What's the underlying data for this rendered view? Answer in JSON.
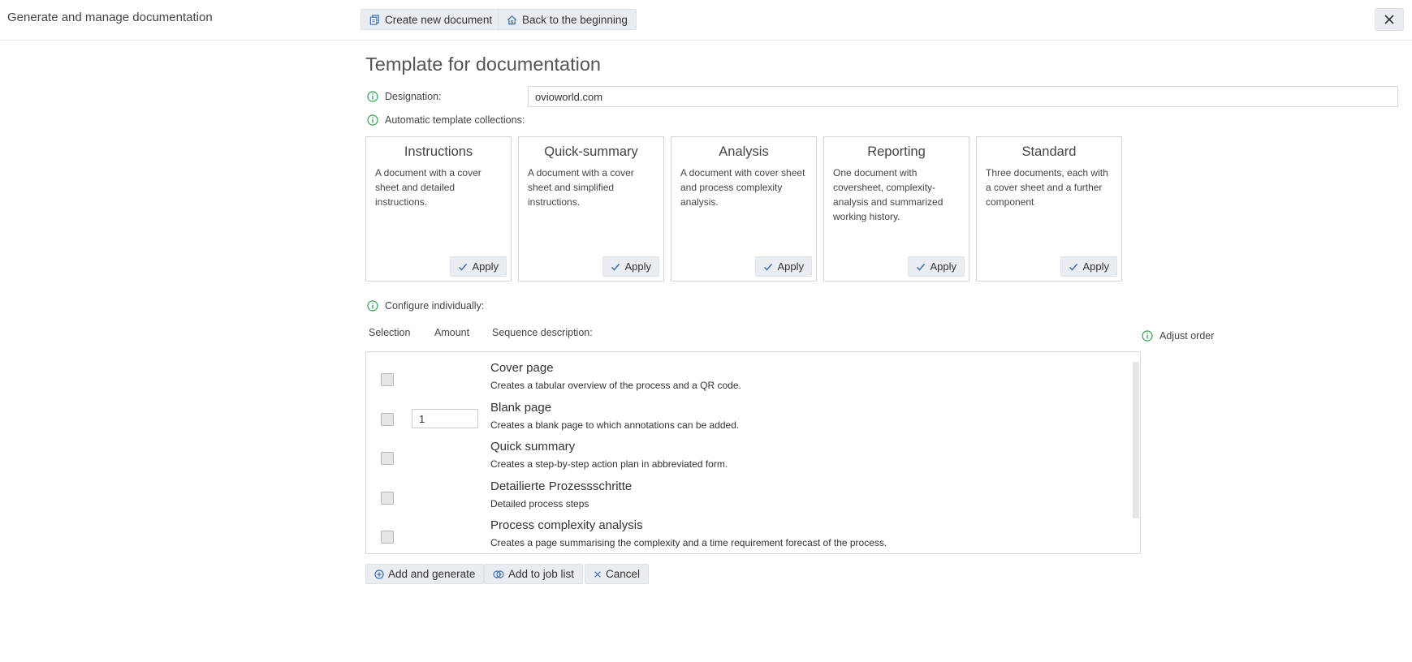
{
  "app": {
    "title": "Generate and manage documentation"
  },
  "toolbar": {
    "create_label": "Create new document",
    "back_label": "Back to the beginning"
  },
  "page": {
    "heading": "Template for documentation"
  },
  "designation": {
    "label": "Designation:",
    "value": "ovioworld.com"
  },
  "automatic": {
    "label": "Automatic template collections:",
    "apply_label": "Apply",
    "cards": [
      {
        "title": "Instructions",
        "description": "A document with a cover sheet and detailed instructions."
      },
      {
        "title": "Quick-summary",
        "description": "A document with a cover sheet and simplified instructions."
      },
      {
        "title": "Analysis",
        "description": "A document with cover sheet and process complexity analysis."
      },
      {
        "title": "Reporting",
        "description": "One document with coversheet, complexity-analysis and summarized working history."
      },
      {
        "title": "Standard",
        "description": "Three documents, each with a cover sheet and a further component"
      }
    ]
  },
  "configure": {
    "label": "Configure individually:",
    "adjust_order_label": "Adjust order",
    "columns": {
      "selection": "Selection",
      "amount": "Amount",
      "description": "Sequence description:"
    },
    "items": [
      {
        "title": "Cover page",
        "description": "Creates a tabular overview of the process and a QR code.",
        "checked": false
      },
      {
        "title": "Blank page",
        "description": "Creates a blank page to which annotations can be added.",
        "checked": false,
        "amount": "1"
      },
      {
        "title": "Quick summary",
        "description": "Creates a step-by-step action plan in abbreviated form.",
        "checked": false
      },
      {
        "title": "Detailierte Prozessschritte",
        "description": "Detailed process steps",
        "checked": false
      },
      {
        "title": "Process complexity analysis",
        "description": "Creates a page summarising the complexity and a time requirement forecast of the process.",
        "checked": false
      }
    ]
  },
  "actions": {
    "add_generate_label": "Add and generate",
    "add_job_label": "Add to job list",
    "cancel_label": "Cancel"
  },
  "colors": {
    "info_green": "#2e9e4f",
    "icon_blue": "#3d6fb3",
    "button_bg": "#e9edf1"
  }
}
